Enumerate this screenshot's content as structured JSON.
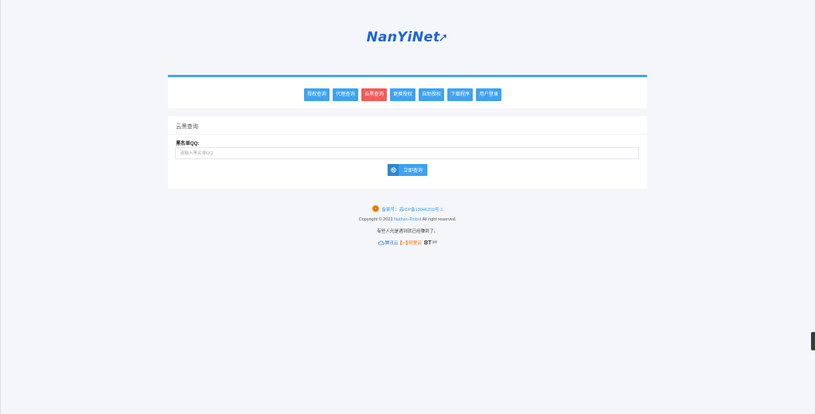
{
  "brand": {
    "logo_text": "NanYiNet"
  },
  "nav": {
    "buttons": [
      "授权查询",
      "代理查询",
      "云黑查询",
      "更换授权",
      "自助授权",
      "下载程序",
      "用户登录"
    ],
    "active_index": 2
  },
  "query": {
    "title": "云黑查询",
    "field_label": "黑名单QQ:",
    "input_value": "",
    "input_placeholder": "请输入黑名单QQ",
    "submit_label": "立即查询"
  },
  "footer": {
    "icp": "备案号：苏ICP备13046209号-1",
    "copyright_prefix": "Copyright © 2022",
    "copyright_author": "Nathan-Robot",
    "copyright_suffix": "All right reserved.",
    "slogan": "有些人光是遇到就已经赚到了。",
    "partners": {
      "tencent": "腾讯云",
      "aliyun": "阿里云",
      "bt": "BT",
      "bt_sub": "宝塔"
    }
  },
  "colors": {
    "primary": "#3fa2f0",
    "active": "#f25b5b",
    "brand": "#1c63d6"
  }
}
